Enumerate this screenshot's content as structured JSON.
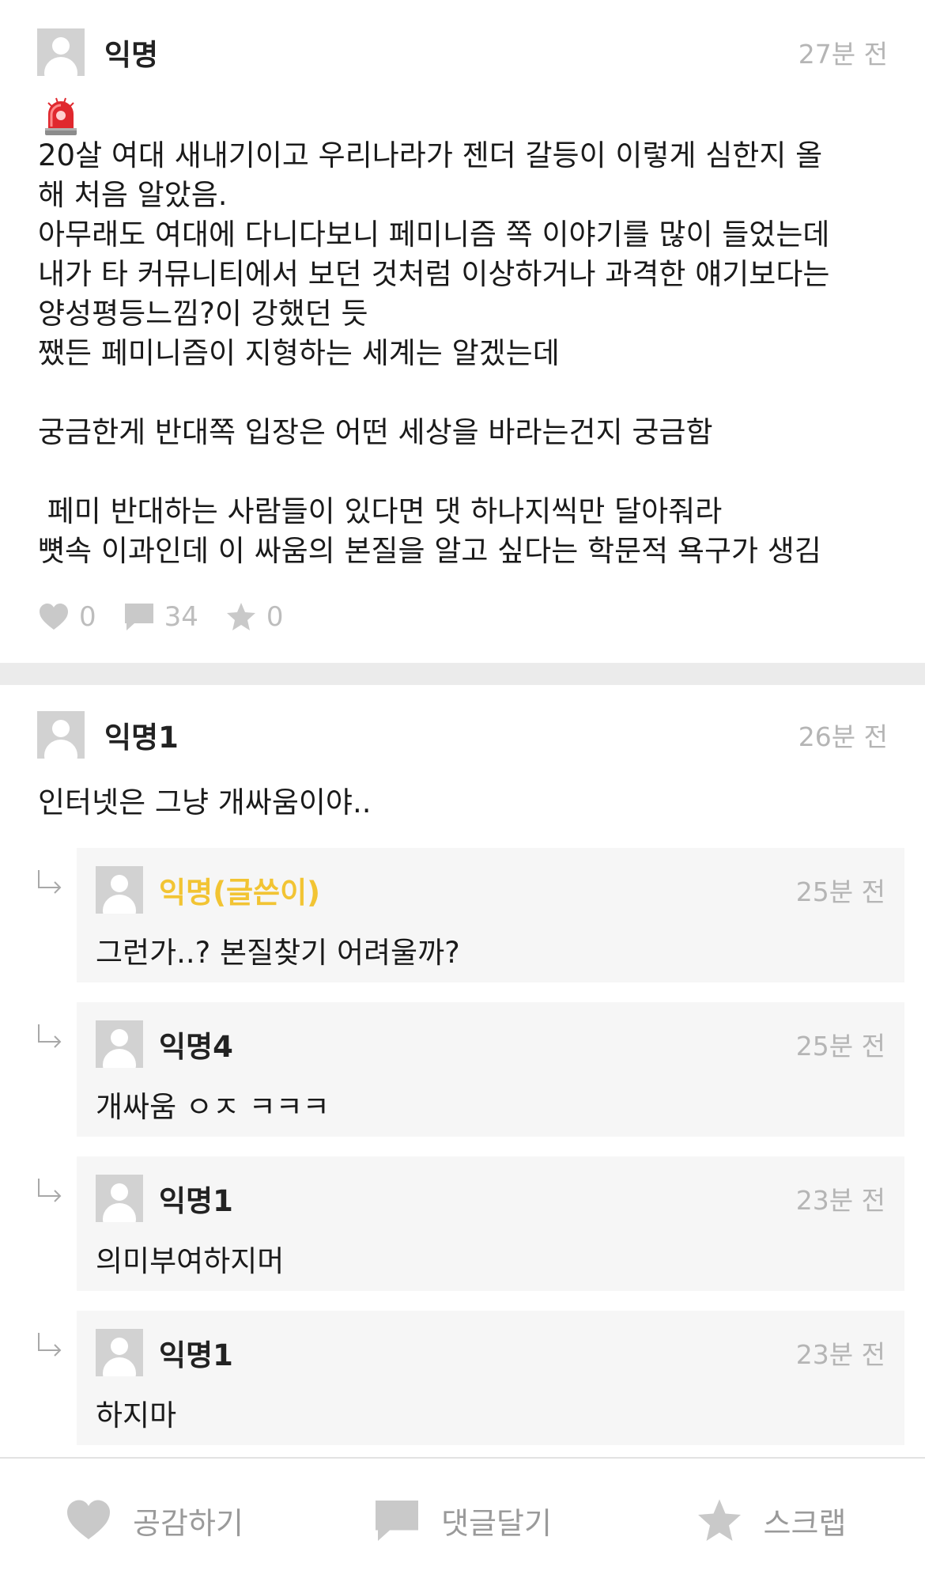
{
  "post": {
    "author": "익명",
    "time": "27분 전",
    "emoji": "siren-emoji",
    "body": "20살 여대 새내기이고 우리나라가 젠더 갈등이 이렇게 심한지 올\n해 처음 알았음.\n아무래도 여대에 다니다보니 페미니즘 쪽 이야기를 많이 들었는데\n내가 타 커뮤니티에서 보던 것처럼 이상하거나 과격한 얘기보다는\n양성평등느낌?이 강했던 듯\n쨌든 페미니즘이 지형하는 세계는 알겠는데\n\n궁금한게 반대쪽 입장은 어떤 세상을 바라는건지 궁금함\n\n 페미 반대하는 사람들이 있다면 댓 하나지씩만 달아줘라\n뼛속 이과인데 이 싸움의 본질을 알고 싶다는 학문적 욕구가 생김",
    "likes": "0",
    "comments": "34",
    "scraps": "0"
  },
  "comment": {
    "author": "익명1",
    "time": "26분 전",
    "text": "인터넷은 그냥 개싸움이야.."
  },
  "replies": [
    {
      "author": "익명(글쓴이)",
      "time": "25분 전",
      "text": "그런가..? 본질찾기 어려울까?",
      "is_op": true
    },
    {
      "author": "익명4",
      "time": "25분 전",
      "text": "개싸움 ㅇㅈ ㅋㅋㅋ",
      "is_op": false
    },
    {
      "author": "익명1",
      "time": "23분 전",
      "text": "의미부여하지머",
      "is_op": false
    },
    {
      "author": "익명1",
      "time": "23분 전",
      "text": "하지마",
      "is_op": false
    }
  ],
  "bottom_bar": {
    "like_label": "공감하기",
    "comment_label": "댓글달기",
    "scrap_label": "스크랩"
  },
  "colors": {
    "op_author": "#f2c433",
    "muted": "#b5b5b5",
    "reply_bg": "#f6f6f6",
    "divider": "#ebebeb"
  }
}
